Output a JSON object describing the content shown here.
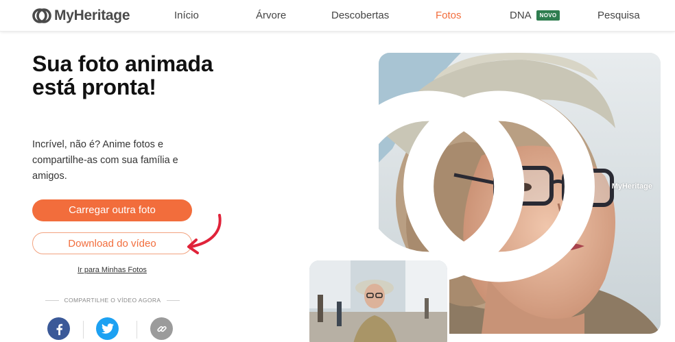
{
  "brand": {
    "name": "MyHeritage",
    "logo_icon": "myheritage-logo-icon"
  },
  "nav": {
    "items": [
      {
        "label": "Início"
      },
      {
        "label": "Árvore"
      },
      {
        "label": "Descobertas"
      },
      {
        "label": "Fotos",
        "active": true
      },
      {
        "label": "DNA",
        "badge": "NOVO"
      },
      {
        "label": "Pesquisa"
      }
    ]
  },
  "main": {
    "title": "Sua foto animada está pronta!",
    "subtitle": "Incrível, não é? Anime fotos e compartilhe-as com sua família e amigos.",
    "upload_button": "Carregar outra foto",
    "download_button": "Download do vídeo",
    "my_photos_link": "Ir para Minhas Fotos",
    "share_heading": "COMPARTILHE O VÍDEO AGORA",
    "share_icons": [
      "facebook-icon",
      "twitter-icon",
      "link-icon"
    ]
  },
  "preview": {
    "watermark": "MyHeritage"
  },
  "colors": {
    "accent": "#f26d3c",
    "badge": "#2e7d4f",
    "facebook": "#3b5998",
    "twitter": "#1da1f2",
    "link": "#9b9b9b",
    "annotation_arrow": "#e0233a"
  }
}
